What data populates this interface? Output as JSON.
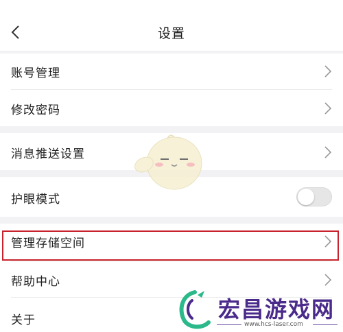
{
  "header": {
    "title": "设置",
    "back_icon": "chevron-left-icon"
  },
  "settings": {
    "account": "账号管理",
    "password": "修改密码",
    "push": "消息推送设置",
    "eye_mode": "护眼模式",
    "eye_mode_enabled": false,
    "storage": "管理存储空间",
    "help": "帮助中心",
    "about": "关于"
  },
  "colors": {
    "highlight": "#c8232c",
    "background": "#f2f2f4"
  },
  "watermark": {
    "brand": "宏昌游戏网",
    "url": "www.hcs-laser.com"
  }
}
